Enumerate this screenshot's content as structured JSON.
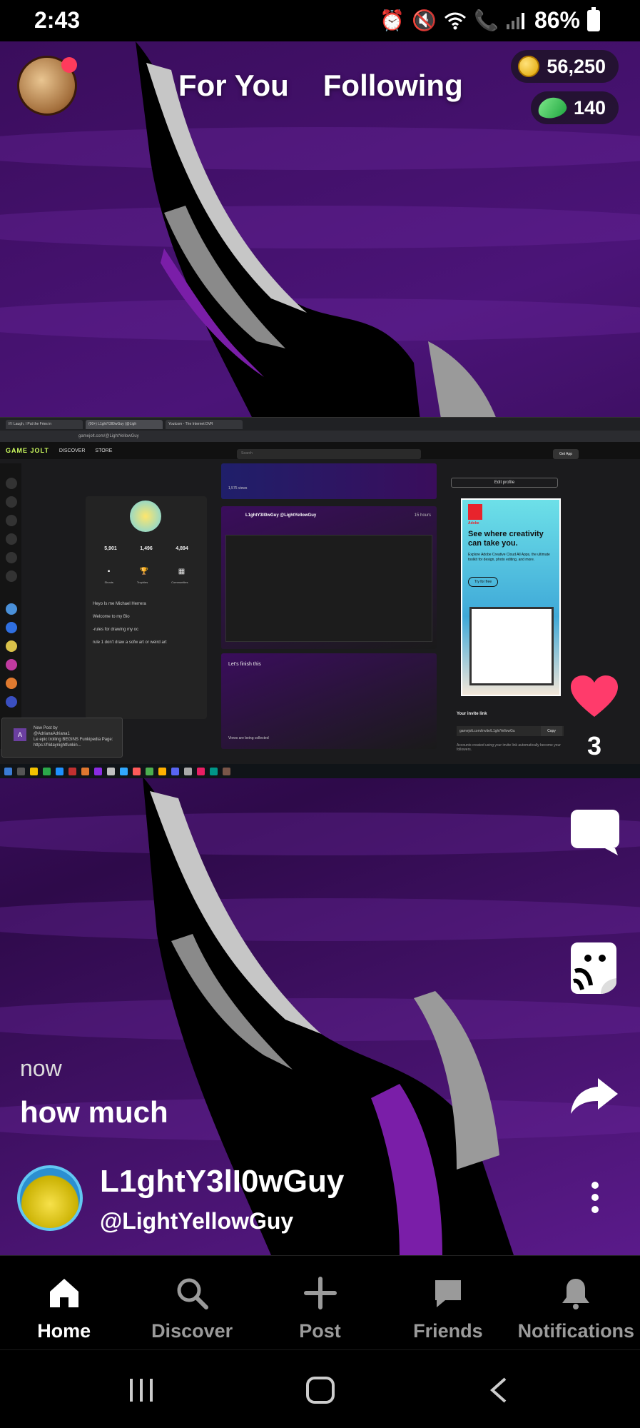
{
  "status_bar": {
    "time": "2:43",
    "battery": "86%",
    "icons": [
      "alarm-icon",
      "mute-icon",
      "wifi-icon",
      "wifi-calling-icon",
      "signal-icon",
      "battery-icon"
    ]
  },
  "top_nav": {
    "tabs": [
      {
        "label": "For You",
        "active": true
      },
      {
        "label": "Following",
        "active": false
      }
    ],
    "coins": "56,250",
    "gems": "140"
  },
  "embedded_screenshot": {
    "browser_tabs": [
      "If I Laugh, I Put the Fries in",
      "(00+) L1ghtY3ll0wGuy (@Ligh",
      "Youtcom - The Internet DVR"
    ],
    "url": "gamejolt.com/@LightYellowGuy",
    "site_logo": "GAME JOLT",
    "nav_links": [
      "DISCOVER",
      "STORE"
    ],
    "search_placeholder": "Search",
    "get_app": "Get App",
    "stats": {
      "following": "5,901",
      "followers": "1,496",
      "likes": "4,894"
    },
    "stat_labels": [
      "Shouts",
      "Trophies",
      "Communities"
    ],
    "bio_lines": [
      "Heyo Is me Michael Herrera",
      "Welcome to my Bio",
      "-rules for drawing my oc",
      "rule 1 don't draw a sofw art or weird art"
    ],
    "post_author": "L1ghtY3ll0wGuy @LightYellowGuy",
    "post_time": "15 hours",
    "post_views": "1,575 views",
    "finish_text": "Let's finish this",
    "views_collected": "Views are being collected",
    "edit_profile": "Edit profile",
    "ad": {
      "brand": "Adobe",
      "title": "See where creativity can take you.",
      "text": "Explore Adobe Creative Cloud All Apps, the ultimate toolkit for design, photo editing, and more.",
      "button": "Try for free"
    },
    "invite_title": "Your invite link",
    "invite_url": "gamejolt.com/invite/L1ghtYellowGu",
    "invite_copy": "Copy",
    "invite_note": "Accounts created using your invite link automatically become your followers.",
    "toast_title": "New Post by",
    "toast_author": "@AdrianaAdriana1",
    "toast_text": "Le epic trolling BEGINS Funkipedia Page: https://fridaynightfunkin..."
  },
  "actions": {
    "like_count": "3"
  },
  "post": {
    "time": "now",
    "caption": "how much",
    "author_name": "L1ghtY3lI0wGuy",
    "author_handle": "@LightYellowGuy"
  },
  "bottom_nav": [
    {
      "label": "Home",
      "icon": "home-icon",
      "active": true
    },
    {
      "label": "Discover",
      "icon": "search-icon",
      "active": false
    },
    {
      "label": "Post",
      "icon": "plus-icon",
      "active": false
    },
    {
      "label": "Friends",
      "icon": "chat-icon",
      "active": false
    },
    {
      "label": "Notifications",
      "icon": "bell-icon",
      "active": false
    }
  ],
  "colors": {
    "like": "#ff3b6b",
    "purple_bg": "#4b1478",
    "inactive_nav": "#9a9a9a"
  }
}
